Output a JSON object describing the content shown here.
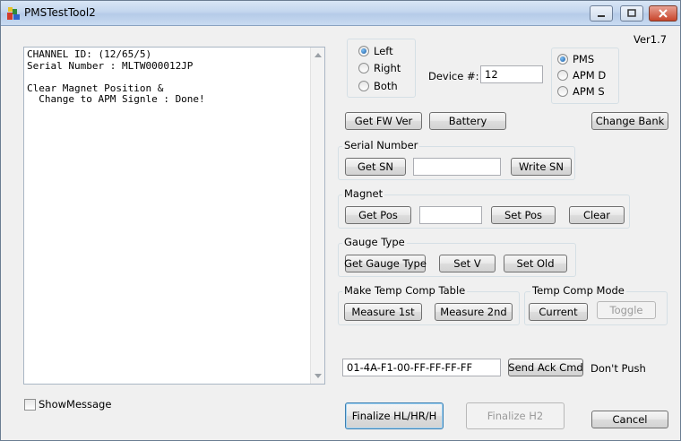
{
  "window": {
    "title": "PMSTestTool2",
    "version": "Ver1.7"
  },
  "log": {
    "lines": "CHANNEL ID: (12/65/5)\nSerial Number : MLTW000012JP\n\nClear Magnet Position &\n  Change to APM Signle : Done!"
  },
  "side": {
    "options": [
      "Left",
      "Right",
      "Both"
    ],
    "selected": "Left"
  },
  "device": {
    "label": "Device #:",
    "value": "12"
  },
  "mode": {
    "options": [
      "PMS",
      "APM D",
      "APM S"
    ],
    "selected": "PMS"
  },
  "top_buttons": {
    "get_fw": "Get FW Ver",
    "battery": "Battery",
    "change_bank": "Change Bank"
  },
  "serial": {
    "title": "Serial Number",
    "get": "Get SN",
    "value": "",
    "write": "Write SN"
  },
  "magnet": {
    "title": "Magnet",
    "get": "Get Pos",
    "value": "",
    "set": "Set Pos",
    "clear": "Clear"
  },
  "gauge": {
    "title": "Gauge Type",
    "get": "Get Gauge Type",
    "set_v": "Set V",
    "set_old": "Set Old"
  },
  "temp_table": {
    "title": "Make Temp Comp Table",
    "measure1": "Measure 1st",
    "measure2": "Measure 2nd"
  },
  "temp_mode": {
    "title": "Temp Comp Mode",
    "current": "Current",
    "toggle": "Toggle"
  },
  "ack": {
    "value": "01-4A-F1-00-FF-FF-FF-FF",
    "send": "Send Ack Cmd",
    "note": "Don't Push"
  },
  "footer": {
    "show_message": "ShowMessage",
    "show_message_checked": false,
    "finalize1": "Finalize HL/HR/H",
    "finalize2": "Finalize H2",
    "cancel": "Cancel"
  }
}
